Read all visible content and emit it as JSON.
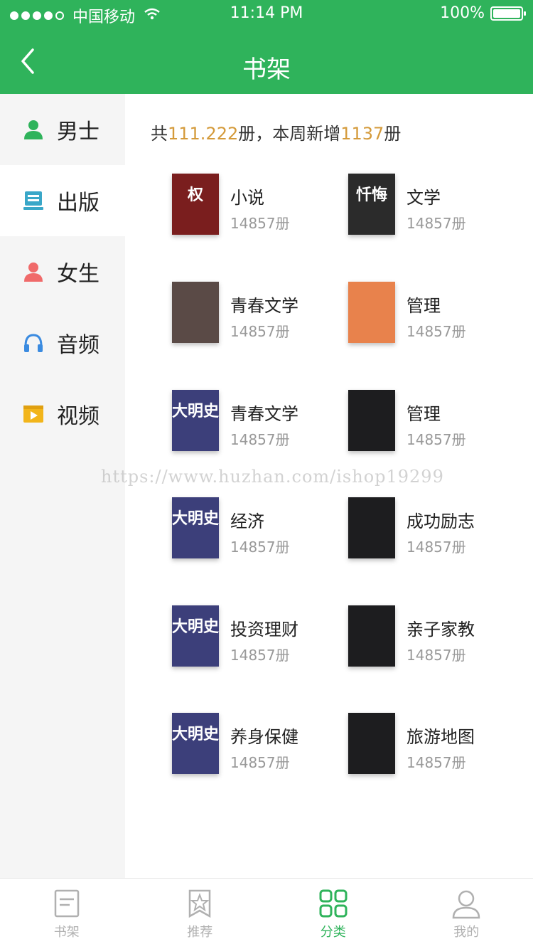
{
  "status": {
    "carrier": "中国移动",
    "time": "11:14 PM",
    "battery": "100%"
  },
  "nav": {
    "title": "书架"
  },
  "sidebar": {
    "items": [
      {
        "label": "男士",
        "icon": "person-icon",
        "color": "#2fb35b",
        "active": false
      },
      {
        "label": "出版",
        "icon": "publish-icon",
        "color": "#3aa7c8",
        "active": true
      },
      {
        "label": "女生",
        "icon": "person-icon",
        "color": "#f06a6a",
        "active": false
      },
      {
        "label": "音频",
        "icon": "headphones-icon",
        "color": "#3b8be0",
        "active": false
      },
      {
        "label": "视频",
        "icon": "video-icon",
        "color": "#f2b51b",
        "active": false
      }
    ]
  },
  "summary": {
    "prefix": "共",
    "total": "111.222",
    "middle": "册，本周新增",
    "new_count": "1137",
    "suffix": "册"
  },
  "categories": [
    {
      "name": "小说",
      "count": "14857册",
      "cover_text": "权",
      "cover_color": "#7a1e1e"
    },
    {
      "name": "文学",
      "count": "14857册",
      "cover_text": "忏悔",
      "cover_color": "#2b2b2b"
    },
    {
      "name": "青春文学",
      "count": "14857册",
      "cover_text": "",
      "cover_color": "#5a4a46"
    },
    {
      "name": "管理",
      "count": "14857册",
      "cover_text": "",
      "cover_color": "#e8824c"
    },
    {
      "name": "青春文学",
      "count": "14857册",
      "cover_text": "大明史",
      "cover_color": "#3c3f7a"
    },
    {
      "name": "管理",
      "count": "14857册",
      "cover_text": "",
      "cover_color": "#1d1d1f"
    },
    {
      "name": "经济",
      "count": "14857册",
      "cover_text": "大明史",
      "cover_color": "#3c3f7a"
    },
    {
      "name": "成功励志",
      "count": "14857册",
      "cover_text": "",
      "cover_color": "#1d1d1f"
    },
    {
      "name": "投资理财",
      "count": "14857册",
      "cover_text": "大明史",
      "cover_color": "#3c3f7a"
    },
    {
      "name": "亲子家教",
      "count": "14857册",
      "cover_text": "",
      "cover_color": "#1d1d1f"
    },
    {
      "name": "养身保健",
      "count": "14857册",
      "cover_text": "大明史",
      "cover_color": "#3c3f7a"
    },
    {
      "name": "旅游地图",
      "count": "14857册",
      "cover_text": "",
      "cover_color": "#1d1d1f"
    }
  ],
  "watermark": "https://www.huzhan.com/ishop19299",
  "tabs": [
    {
      "label": "书架",
      "icon": "bookshelf-icon",
      "active": false
    },
    {
      "label": "推荐",
      "icon": "star-icon",
      "active": false
    },
    {
      "label": "分类",
      "icon": "category-icon",
      "active": true
    },
    {
      "label": "我的",
      "icon": "profile-icon",
      "active": false
    }
  ],
  "colors": {
    "primary": "#2fb35b",
    "highlight": "#d49a3a",
    "muted": "#999999"
  }
}
